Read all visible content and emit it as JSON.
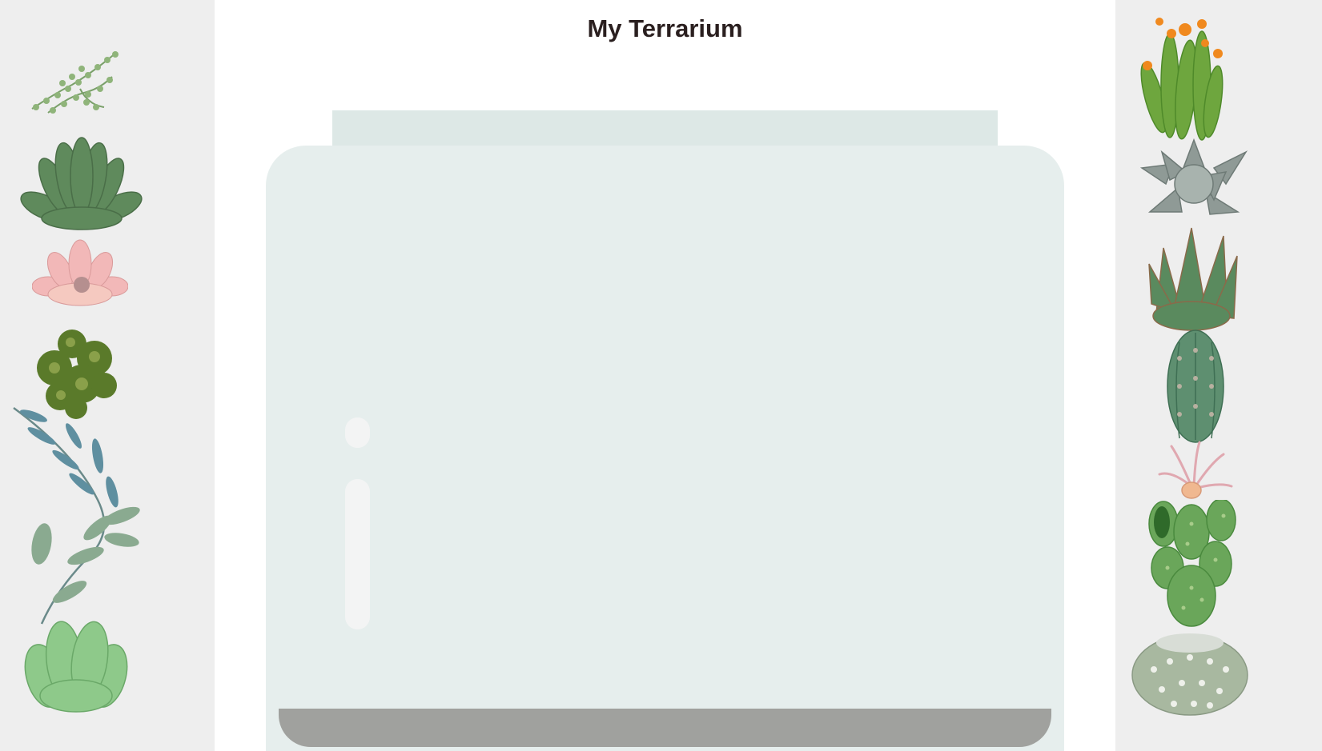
{
  "page": {
    "title": "My Terrarium"
  },
  "colors": {
    "sidebar": "#eeeeee",
    "jar_glass": "#e6eeed",
    "jar_lid": "#dde8e6",
    "jar_soil": "#a0a19e",
    "title": "#2a1f1f"
  },
  "left_plants": [
    {
      "icon": "string-of-pearls-icon"
    },
    {
      "icon": "green-rosette-succulent-icon"
    },
    {
      "icon": "pink-succulent-icon"
    },
    {
      "icon": "clustered-succulent-icon"
    },
    {
      "icon": "eucalyptus-branch-icon"
    },
    {
      "icon": "jade-succulent-icon"
    }
  ],
  "right_plants": [
    {
      "icon": "flowering-cactus-icon"
    },
    {
      "icon": "gray-echeveria-icon"
    },
    {
      "icon": "spiky-succulent-icon"
    },
    {
      "icon": "column-cactus-icon"
    },
    {
      "icon": "air-plant-icon"
    },
    {
      "icon": "paddle-cactus-icon"
    },
    {
      "icon": "round-cactus-icon"
    }
  ]
}
